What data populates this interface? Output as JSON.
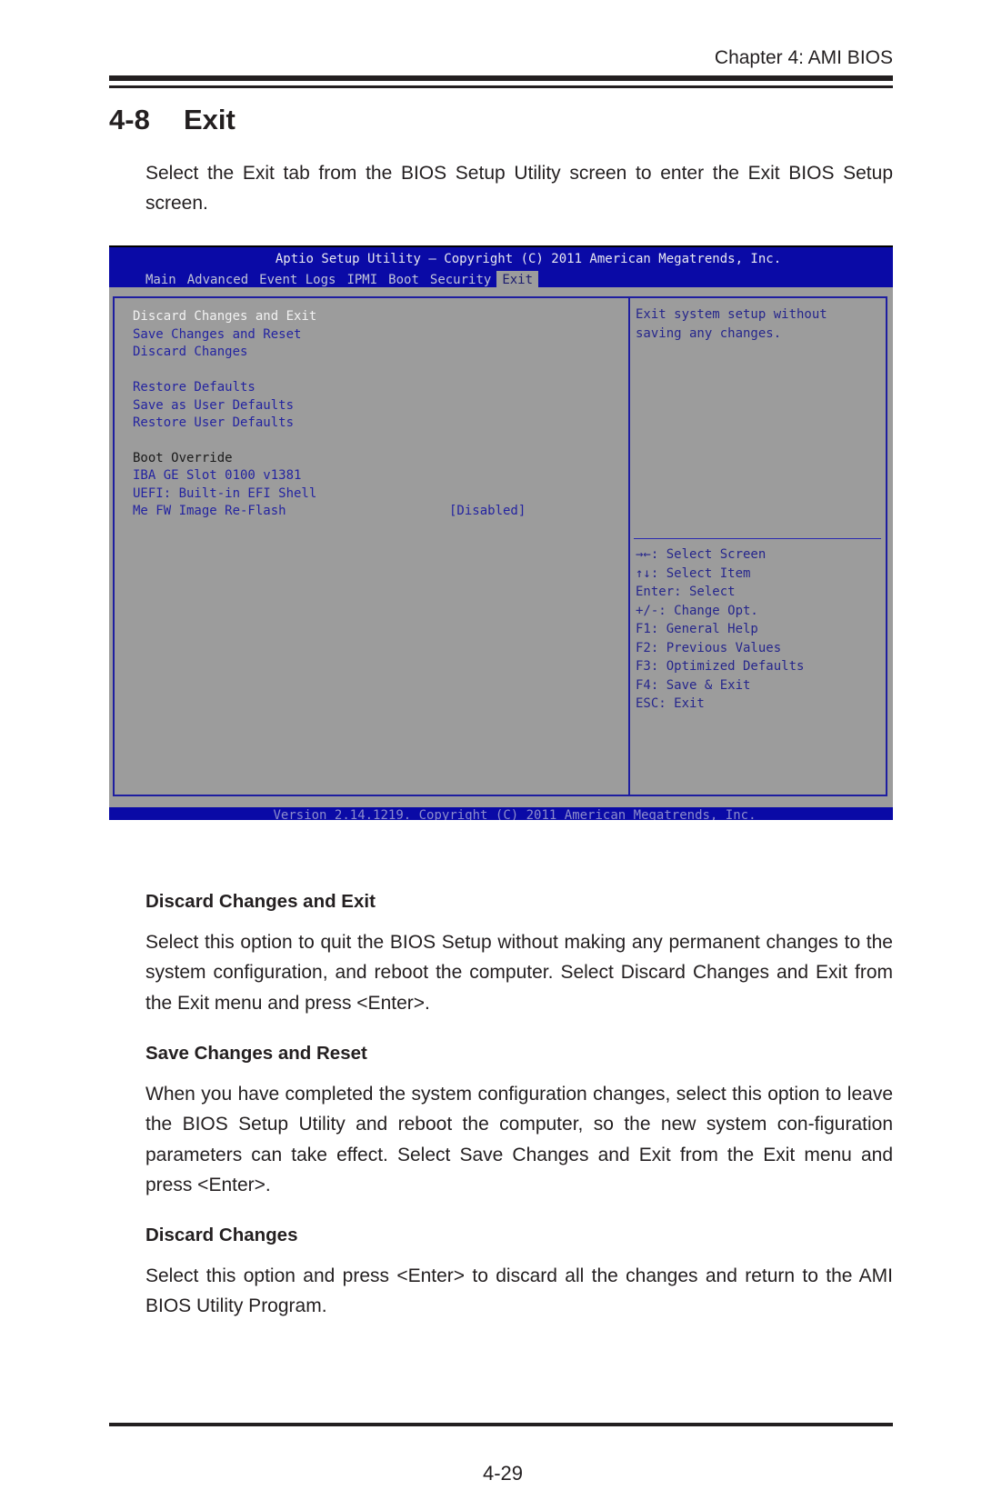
{
  "page": {
    "running_head": "Chapter 4: AMI BIOS",
    "section_number": "4-8",
    "section_title": "Exit",
    "intro": "Select the Exit tab from the BIOS Setup Utility screen to enter the Exit BIOS Setup screen.",
    "page_number": "4-29"
  },
  "bios": {
    "title": "Aptio Setup Utility – Copyright (C) 2011 American Megatrends, Inc.",
    "tabs": [
      {
        "label": "Main",
        "active": false
      },
      {
        "label": "Advanced",
        "active": false
      },
      {
        "label": "Event Logs",
        "active": false
      },
      {
        "label": "IPMI",
        "active": false
      },
      {
        "label": "Boot",
        "active": false
      },
      {
        "label": "Security",
        "active": false
      },
      {
        "label": "Exit",
        "active": true
      }
    ],
    "menu": [
      {
        "label": "Discard Changes and Exit",
        "selected": true
      },
      {
        "label": "Save Changes and Reset"
      },
      {
        "label": "Discard Changes"
      },
      {
        "label": "Restore Defaults"
      },
      {
        "label": "Save as User Defaults"
      },
      {
        "label": "Restore User Defaults"
      },
      {
        "label": "Boot Override",
        "header": true
      },
      {
        "label": "IBA GE Slot 0100 v1381"
      },
      {
        "label": "UEFI: Built-in EFI Shell"
      },
      {
        "label": "Me FW Image Re-Flash",
        "value": "[Disabled]"
      }
    ],
    "help_text_lines": [
      "Exit system setup without",
      "saving any changes."
    ],
    "keys": [
      "→←: Select Screen",
      "↑↓: Select Item",
      "Enter: Select",
      "+/-: Change Opt.",
      "F1: General Help",
      "F2: Previous Values",
      "F3: Optimized Defaults",
      "F4: Save & Exit",
      "ESC: Exit"
    ],
    "footer": "Version 2.14.1219. Copyright (C) 2011 American Megatrends, Inc.",
    "colors": {
      "blue": "#0a0aa6",
      "gray": "#9c9c9c",
      "text_blue": "#2424a0",
      "selected": "#f2f2f2"
    }
  },
  "sections": [
    {
      "heading": "Discard Changes and Exit",
      "body": "Select this option to quit the BIOS Setup without making any permanent changes to the system configuration, and reboot the computer. Select Discard Changes and Exit from the Exit menu and press <Enter>."
    },
    {
      "heading": "Save Changes and Reset",
      "body": "When you have completed the system configuration changes, select this option to leave the BIOS Setup Utility and reboot the computer, so the new system con-figuration parameters can take effect. Select Save Changes and Exit from the Exit menu and press <Enter>."
    },
    {
      "heading": "Discard Changes",
      "body": "Select this option and press <Enter> to discard all the changes and return to the AMI BIOS Utility Program."
    }
  ]
}
